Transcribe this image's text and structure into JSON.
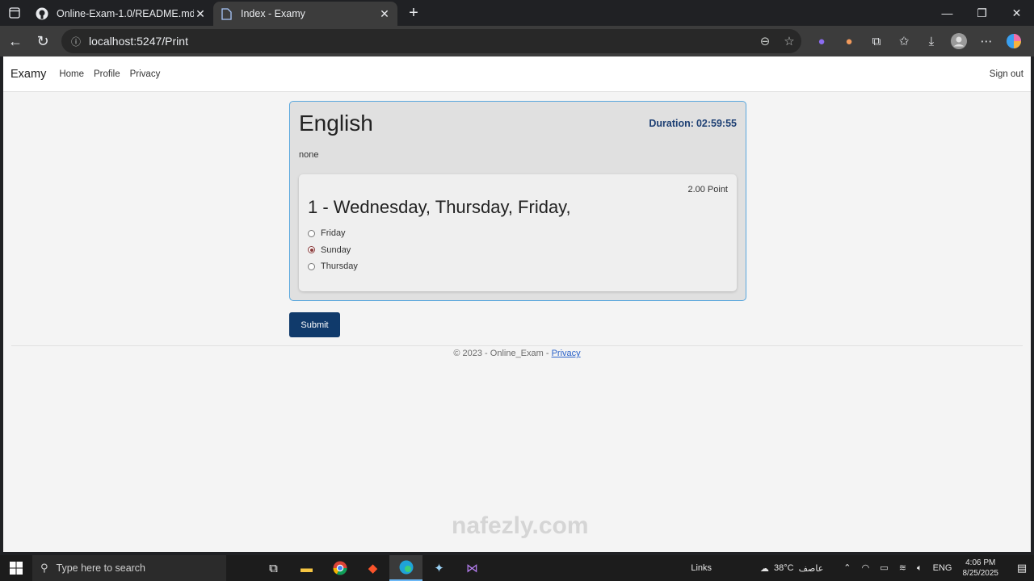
{
  "browser": {
    "tabs": [
      {
        "title": "Online-Exam-1.0/README.md at",
        "favicon": "github-icon",
        "active": false
      },
      {
        "title": "Index - Examy",
        "favicon": "page-icon",
        "active": true
      }
    ],
    "url": "localhost:5247/Print"
  },
  "site": {
    "brand": "Examy",
    "nav": [
      "Home",
      "Profile",
      "Privacy"
    ],
    "signout": "Sign out"
  },
  "exam": {
    "title": "English",
    "duration_label": "Duration:",
    "duration_value": "02:59:55",
    "description": "none",
    "question": {
      "points": "2.00 Point",
      "text": "1 - Wednesday, Thursday, Friday,",
      "options": [
        {
          "label": "Friday",
          "checked": false
        },
        {
          "label": "Sunday",
          "checked": true
        },
        {
          "label": "Thursday",
          "checked": false
        }
      ]
    },
    "submit_label": "Submit"
  },
  "footer": {
    "text": "© 2023 - Online_Exam - ",
    "link": "Privacy"
  },
  "watermark": "nafezly.com",
  "taskbar": {
    "search_placeholder": "Type here to search",
    "links": "Links",
    "weather_temp": "38°C",
    "weather_desc": "عاصف",
    "lang": "ENG",
    "time": "4:06 PM",
    "date": "8/25/2025"
  }
}
